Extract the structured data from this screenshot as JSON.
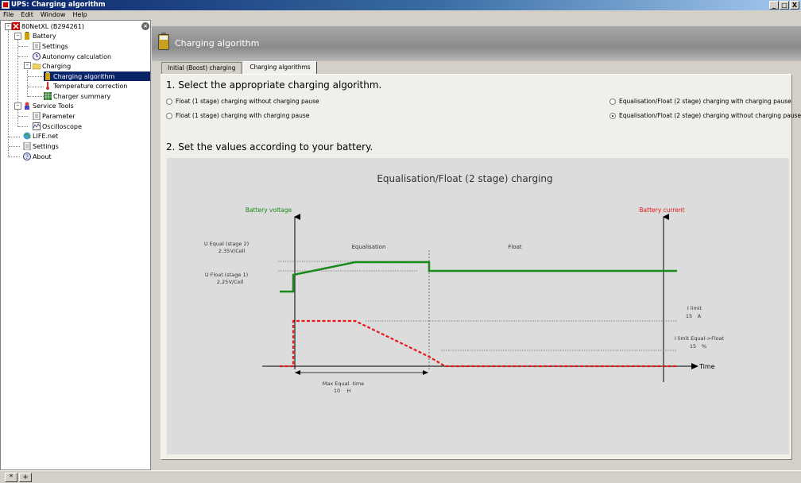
{
  "window": {
    "title": "UPS: Charging algorithm",
    "buttons": [
      "_",
      "□",
      "X"
    ]
  },
  "menu": [
    "File",
    "Edit",
    "Window",
    "Help"
  ],
  "tree": {
    "root": "80NetXL (B294261)",
    "battery": "Battery",
    "settings": "Settings",
    "autonomy": "Autonomy calculation",
    "charging": "Charging",
    "charging_algorithm": "Charging algorithm",
    "temperature": "Temperature correction",
    "charger_summary": "Charger summary",
    "service_tools": "Service Tools",
    "parameter": "Parameter",
    "oscilloscope": "Oscilloscope",
    "life_net": "LIFE.net",
    "settings2": "Settings",
    "about": "About"
  },
  "header": {
    "title": "Charging algorithm"
  },
  "tabs": [
    "Initial (Boost) charging",
    "Charging algorithms"
  ],
  "section1": "1. Select the appropriate charging algorithm.",
  "options": {
    "float_no_pause": "Float (1 stage) charging without charging pause",
    "float_pause": "Float (1 stage) charging with charging pause",
    "equal_pause": "Equalisation/Float (2 stage) charging with charging pause",
    "equal_no_pause": "Equalisation/Float (2 stage) charging without charging pause"
  },
  "selected_option": "equal_no_pause",
  "section2": "2. Set the values according to your battery.",
  "diagram": {
    "title": "Equalisation/Float (2 stage) charging",
    "battery_voltage": "Battery voltage",
    "battery_current": "Battery current",
    "u_equal_label": "U Equal (stage 2)",
    "u_equal_value": "2.35",
    "u_equal_unit": "V/Cell",
    "u_float_label": "U Float (stage 1)",
    "u_float_value": "2.25",
    "u_float_unit": "V/Cell",
    "equalisation": "Equalisation",
    "float": "Float",
    "i_limit_label": "I limit",
    "i_limit_value": "15",
    "i_limit_unit": "A",
    "i_limit_ef_label": "I limit Equal->Float",
    "i_limit_ef_value": "15",
    "i_limit_ef_unit": "%",
    "time": "Time",
    "max_equal_label": "Max Equal. time",
    "max_equal_value": "10",
    "max_equal_unit": "H",
    "colors": {
      "voltage": "#1a8a1a",
      "current": "#e81818",
      "axis": "#000000"
    }
  },
  "bottom_buttons": [
    "*",
    "+"
  ]
}
